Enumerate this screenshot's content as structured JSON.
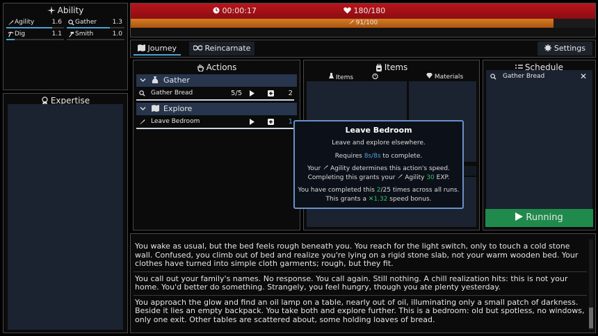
{
  "ability": {
    "title": "Ability",
    "items": [
      {
        "name": "Agility",
        "value": "1.6",
        "icon": "feather-icon",
        "progress": 0.8
      },
      {
        "name": "Gather",
        "value": "1.3",
        "icon": "magnifier-icon",
        "progress": 0.75
      },
      {
        "name": "Dig",
        "value": "1.1",
        "icon": "pickaxe-icon",
        "progress": 0.15
      },
      {
        "name": "Smith",
        "value": "1.0",
        "icon": "hammer-icon",
        "progress": 0.0
      }
    ]
  },
  "expertise": {
    "title": "Expertise"
  },
  "status": {
    "timer": "00:00:17",
    "health": "180/180",
    "energy": "91/100",
    "energy_fraction": 0.91,
    "colors": {
      "health": "#b9141b",
      "energy": "#d67b22"
    }
  },
  "tabs": {
    "journey": "Journey",
    "reincarnate": "Reincarnate",
    "settings": "Settings"
  },
  "actions": {
    "title": "Actions",
    "groups": [
      {
        "label": "Gather",
        "rows": [
          {
            "label": "Gather Bread",
            "count": "5/5",
            "number": "2"
          }
        ]
      },
      {
        "label": "Explore",
        "rows": [
          {
            "label": "Leave Bedroom",
            "number": "1"
          }
        ]
      }
    ]
  },
  "items": {
    "title": "Items",
    "tab_items": "Items",
    "tab_materials": "Materials"
  },
  "schedule": {
    "title": "Schedule",
    "entries": [
      "Gather Bread"
    ],
    "running_label": "Running"
  },
  "tooltip": {
    "title": "Leave Bedroom",
    "description": "Leave and explore elsewhere.",
    "requires_prefix": "Requires ",
    "requires_value": "8s/8s",
    "requires_suffix": " to complete.",
    "speed_line_a": "Your ",
    "speed_line_b": "Agility determines this action's speed.",
    "exp_line_a": "Completing this grants your ",
    "exp_line_b": "Agility ",
    "exp_value": "30",
    "exp_line_c": " EXP.",
    "completed_a": "You have completed this ",
    "completed_value": "2",
    "completed_b": "/25 times across all runs.",
    "bonus_a": "This grants a ",
    "bonus_value": "✕1.32",
    "bonus_b": " speed bonus."
  },
  "log": [
    "You wake as usual, but the bed feels rough beneath you. You reach for the light switch, only to touch a cold stone wall. Confused, you climb out of bed and realize you're lying on a rigid stone slab, not your warm wooden bed. Your clothes have turned into simple cloth garments; rough, but they fit.",
    "You call out your family's names. No response. You call again. Still nothing. A chill realization hits: this is not your home. You'd better do something. Strangely, you feel hungry, though you ate plenty yesterday.",
    "You approach the glow and find an oil lamp on a table, nearly out of oil, illuminating only a small patch of darkness. Beside it lies an empty backpack. You take both and explore further. This is a bedroom: old but spotless, no windows, only one exit. Other tables are scattered about, some holding loaves of bread."
  ]
}
